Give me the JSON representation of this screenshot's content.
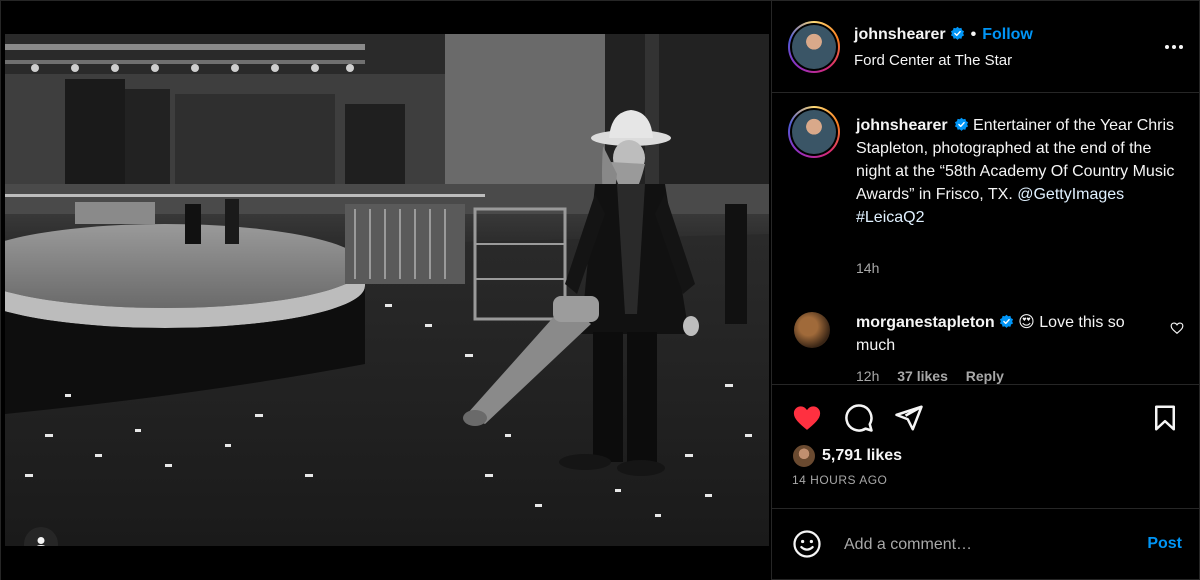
{
  "post": {
    "author": {
      "username": "johnshearer",
      "verified": true,
      "location": "Ford Center at The Star"
    },
    "header": {
      "separator": "•",
      "follow_label": "Follow"
    },
    "caption": {
      "username": "johnshearer",
      "text_before": "Entertainer of the Year Chris Stapleton, photographed at the end of the night at the “58th Academy Of Country Music Awards” in Frisco, TX. ",
      "mention": "@GettyImages",
      "hashtag": "#LeicaQ2",
      "time": "14h"
    },
    "comments": [
      {
        "username": "morganestapleton",
        "verified": true,
        "emoji": "😍",
        "text": "Love this so much",
        "time": "12h",
        "likes": "37 likes",
        "reply_label": "Reply"
      }
    ],
    "likes": {
      "count_label": "5,791 likes",
      "liked": true
    },
    "time_ago": "14 HOURS AGO",
    "add_comment": {
      "placeholder": "Add a comment…",
      "post_label": "Post"
    },
    "colors": {
      "accent_blue": "#0095f6",
      "like_red": "#ff3040",
      "muted": "#a8a8a8",
      "background": "#000000"
    },
    "icons": {
      "more": "more-horizontal-icon",
      "like": "heart-filled-icon",
      "comment": "comment-icon",
      "share": "paper-plane-icon",
      "save": "bookmark-icon",
      "emoji": "smiley-icon",
      "user_tags": "user-tag-icon",
      "verified": "verified-badge-icon"
    }
  }
}
